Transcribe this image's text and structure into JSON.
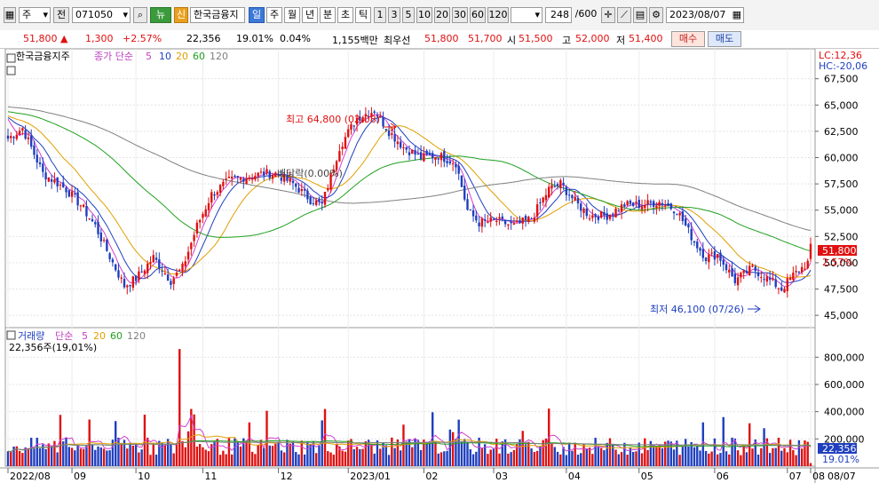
{
  "toolbar": {
    "type_select": "주",
    "scope_label": "전",
    "code": "071050",
    "news_btn": "뉴",
    "credit_btn": "신",
    "name": "한국금융지",
    "periods": [
      "일",
      "주",
      "월",
      "년",
      "분",
      "초",
      "틱"
    ],
    "intervals": [
      "1",
      "3",
      "5",
      "10",
      "20",
      "30",
      "60",
      "120"
    ],
    "count": "248",
    "count_total": "/600",
    "date": "2023/08/07"
  },
  "quote": {
    "price": "51,800",
    "change": "1,300",
    "change_pct": "+2.57%",
    "volume": "22,356",
    "vol_ratio": "19.01%",
    "turnover": "0.04%",
    "amount": "1,155백만",
    "best_label": "최우선",
    "best_ask": "51,800",
    "best_bid": "51,700",
    "open_label": "시",
    "open": "51,500",
    "high_label": "고",
    "high": "52,000",
    "low_label": "저",
    "low": "51,400",
    "buy_btn": "매수",
    "sell_btn": "매도"
  },
  "price_legend": {
    "name": "한국금융지주",
    "type": "종가 단순",
    "ma": [
      "5",
      "10",
      "20",
      "60",
      "120"
    ]
  },
  "vol_legend": {
    "name": "거래량",
    "type": "단순",
    "ma": [
      "5",
      "20",
      "60",
      "120"
    ],
    "current": "22,356주(19,01%)"
  },
  "annotations": {
    "high": "최고 64,800 (02/08)",
    "low": "최저 46,100 (07/26)",
    "dividend": "배당락(0.00%)",
    "lc": "LC:12,36",
    "hc": "HC:-20,06",
    "price_tag": "51,800",
    "pct_tag": "2.57%",
    "vol_tag": "22,356",
    "vol_pct_tag": "19.01%"
  },
  "chart_data": {
    "type": "candlestick",
    "price_axis": [
      "67,500",
      "65,000",
      "62,500",
      "60,000",
      "57,500",
      "55,000",
      "52,500",
      "50,000",
      "47,500",
      "45,000"
    ],
    "volume_axis": [
      "800,000",
      "600,000",
      "400,000",
      "200,000"
    ],
    "x_ticks": [
      "2022/08",
      "09",
      "10",
      "11",
      "12",
      "2023/01",
      "02",
      "03",
      "04",
      "05",
      "06",
      "07",
      "08",
      "08/07"
    ],
    "ylim": [
      45000,
      67500
    ],
    "vol_ylim": [
      0,
      900000
    ],
    "close_anchors": [
      [
        0,
        61800
      ],
      [
        5,
        62800
      ],
      [
        12,
        58500
      ],
      [
        20,
        57000
      ],
      [
        25,
        55500
      ],
      [
        30,
        53500
      ],
      [
        36,
        50000
      ],
      [
        40,
        47800
      ],
      [
        44,
        48500
      ],
      [
        50,
        50500
      ],
      [
        56,
        48300
      ],
      [
        60,
        49500
      ],
      [
        65,
        53500
      ],
      [
        70,
        56500
      ],
      [
        76,
        57800
      ],
      [
        82,
        58200
      ],
      [
        88,
        58500
      ],
      [
        92,
        58500
      ],
      [
        98,
        57500
      ],
      [
        104,
        56000
      ],
      [
        108,
        55500
      ],
      [
        114,
        61000
      ],
      [
        120,
        63800
      ],
      [
        126,
        64500
      ],
      [
        131,
        62500
      ],
      [
        136,
        61000
      ],
      [
        142,
        60000
      ],
      [
        148,
        60200
      ],
      [
        154,
        59500
      ],
      [
        158,
        55000
      ],
      [
        162,
        53800
      ],
      [
        168,
        54000
      ],
      [
        174,
        53500
      ],
      [
        180,
        54200
      ],
      [
        186,
        57000
      ],
      [
        190,
        57500
      ],
      [
        196,
        55500
      ],
      [
        200,
        54500
      ],
      [
        206,
        54500
      ],
      [
        212,
        55500
      ],
      [
        218,
        55500
      ],
      [
        224,
        55800
      ],
      [
        230,
        55000
      ],
      [
        236,
        52000
      ],
      [
        240,
        50500
      ],
      [
        244,
        50800
      ],
      [
        250,
        48300
      ],
      [
        256,
        49500
      ],
      [
        262,
        48300
      ],
      [
        266,
        47500
      ],
      [
        270,
        48800
      ],
      [
        275,
        50000
      ],
      [
        276,
        51800
      ]
    ]
  }
}
